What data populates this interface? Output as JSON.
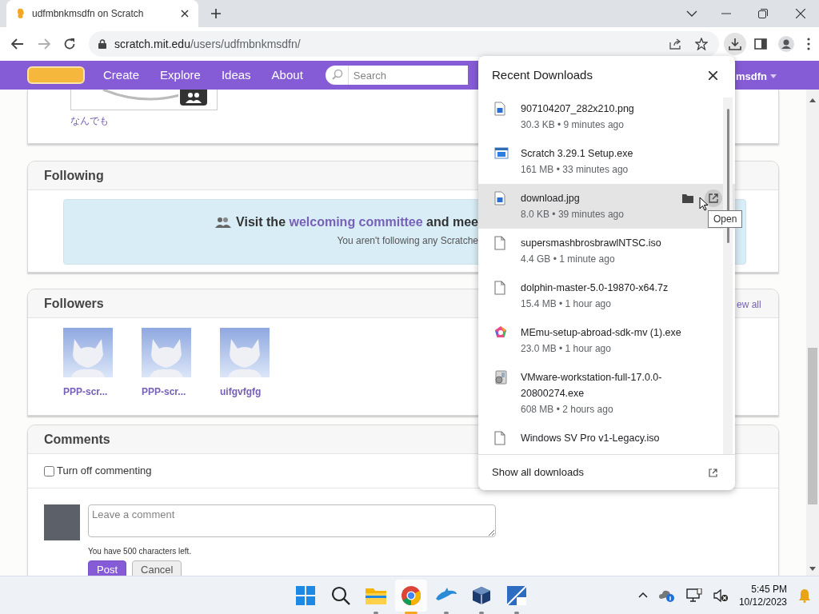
{
  "browser": {
    "tab_title": "udfmbnkmsdfn on Scratch",
    "url_host": "scratch.mit.edu",
    "url_path": "/users/udfmbnkmsdfn/"
  },
  "site_nav": {
    "items": [
      "Create",
      "Explore",
      "Ideas",
      "About"
    ],
    "search_placeholder": "Search",
    "user": "msdfn"
  },
  "profile_card": {
    "link": "なんでも"
  },
  "following": {
    "title": "Following",
    "message_before": "Visit the",
    "message_link": "welcoming committee",
    "message_after": "and mee",
    "subtitle": "You aren't following any Scratche"
  },
  "followers": {
    "title": "Followers",
    "view_all": "ew all",
    "users": [
      {
        "name": "PPP-scr..."
      },
      {
        "name": "PPP-scr..."
      },
      {
        "name": "uifgvfgfg"
      }
    ]
  },
  "comments": {
    "title": "Comments",
    "turn_off": {
      "label": "Turn off commenting",
      "checked": false
    },
    "placeholder": "Leave a comment",
    "chars_left": "You have 500 characters left.",
    "buttons": [
      {
        "label": "Post",
        "kind": "primary"
      },
      {
        "label": "Cancel",
        "kind": "secondary"
      }
    ]
  },
  "downloads": {
    "title": "Recent Downloads",
    "items": [
      {
        "name": "907104207_282x210.png",
        "info": "30.3 KB • 9 minutes ago",
        "kind": "image",
        "hovered": false
      },
      {
        "name": "Scratch 3.29.1 Setup.exe",
        "info": "161 MB • 33 minutes ago",
        "kind": "window",
        "hovered": false
      },
      {
        "name": "download.jpg",
        "info": "8.0 KB • 39 minutes ago",
        "kind": "image",
        "hovered": true
      },
      {
        "name": "supersmashbrosbrawlNTSC.iso",
        "info": "4.4 GB • 1 minute ago",
        "kind": "file",
        "hovered": false
      },
      {
        "name": "dolphin-master-5.0-19870-x64.7z",
        "info": "15.4 MB • 1 hour ago",
        "kind": "file",
        "hovered": false
      },
      {
        "name": "MEmu-setup-abroad-sdk-mv (1).exe",
        "info": "23.0 MB • 1 hour ago",
        "kind": "pentagon",
        "hovered": false
      },
      {
        "name": "VMware-workstation-full-17.0.0-20800274.exe",
        "info": "608 MB • 2 hours ago",
        "kind": "installer",
        "hovered": false
      },
      {
        "name": "Windows SV Pro v1-Legacy.iso",
        "kind": "file",
        "hovered": false
      }
    ],
    "footer": "Show all downloads",
    "tooltip": "Open"
  },
  "taskbar": {
    "apps": [
      {
        "kind": "start",
        "running": false,
        "focused": false
      },
      {
        "kind": "search",
        "running": false,
        "focused": false
      },
      {
        "kind": "folder",
        "running": true,
        "focused": false
      },
      {
        "kind": "browser",
        "running": true,
        "focused": true
      },
      {
        "kind": "dolphin",
        "running": true,
        "focused": false
      },
      {
        "kind": "cube",
        "running": true,
        "focused": false
      },
      {
        "kind": "app",
        "running": true,
        "focused": false
      }
    ],
    "time": "5:45 PM",
    "date": "10/12/2023"
  }
}
